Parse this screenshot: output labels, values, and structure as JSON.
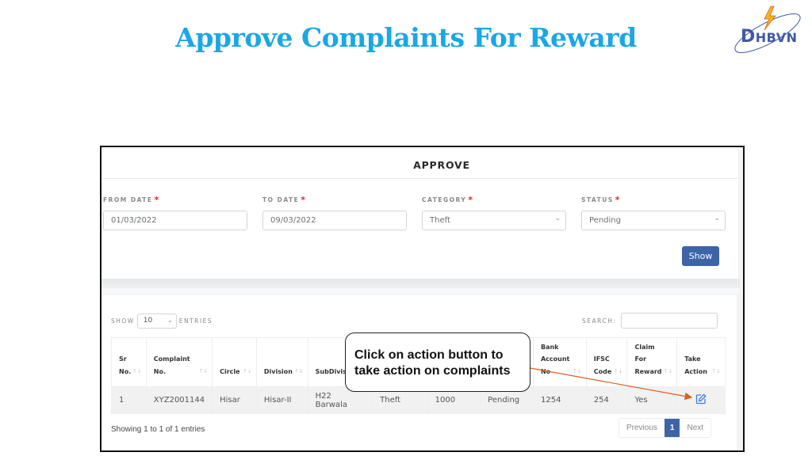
{
  "slide": {
    "title": "Approve Complaints For Reward",
    "logo": {
      "text_big": "D",
      "text_rest": "HBVN"
    }
  },
  "form": {
    "header": "APPROVE",
    "fields": [
      {
        "label": "FROM DATE",
        "required": "*",
        "value": "01/03/2022",
        "type": "date"
      },
      {
        "label": "TO DATE",
        "required": "*",
        "value": "09/03/2022",
        "type": "date"
      },
      {
        "label": "CATEGORY",
        "required": "*",
        "value": "Theft",
        "type": "select"
      },
      {
        "label": "STATUS",
        "required": "*",
        "value": "Pending",
        "type": "select"
      }
    ],
    "show_button": "Show"
  },
  "table": {
    "length_label_pre": "SHOW",
    "length_value": "10",
    "length_label_post": "ENTRIES",
    "search_label": "SEARCH:",
    "search_value": "",
    "columns": [
      {
        "line1": "Sr",
        "line2": "No.",
        "line3": ""
      },
      {
        "line1": "Complaint",
        "line2": "No.",
        "line3": ""
      },
      {
        "line1": "",
        "line2": "Circle",
        "line3": ""
      },
      {
        "line1": "",
        "line2": "Division",
        "line3": ""
      },
      {
        "line1": "",
        "line2": "SubDivisi",
        "line3": ""
      },
      {
        "line1": "",
        "line2": "",
        "line3": ""
      },
      {
        "line1": "",
        "line2": "",
        "line3": ""
      },
      {
        "line1": "",
        "line2": "",
        "line3": ""
      },
      {
        "line1": "Bank",
        "line2": "Account",
        "line3": "No"
      },
      {
        "line1": "",
        "line2": "IFSC",
        "line3": "Code"
      },
      {
        "line1": "Claim",
        "line2": "For",
        "line3": "Reward"
      },
      {
        "line1": "",
        "line2": "Take",
        "line3": "Action"
      }
    ],
    "rows": [
      [
        "1",
        "XYZ2001144",
        "Hisar",
        "Hisar-II",
        "H22 Barwala",
        "Theft",
        "1000",
        "Pending",
        "1254",
        "254",
        "Yes",
        "edit-icon"
      ]
    ],
    "info": "Showing 1 to 1 of 1 entries",
    "pagination": {
      "previous": "Previous",
      "current": "1",
      "next": "Next"
    }
  },
  "callout": {
    "line1": "Click on action button to",
    "line2": "take action on complaints"
  },
  "colors": {
    "title": "#1aa7e6",
    "primary_button": "#3e64a8",
    "required": "#e02424",
    "arrow": "#d9601e",
    "edit_icon": "#3b7dd8"
  }
}
